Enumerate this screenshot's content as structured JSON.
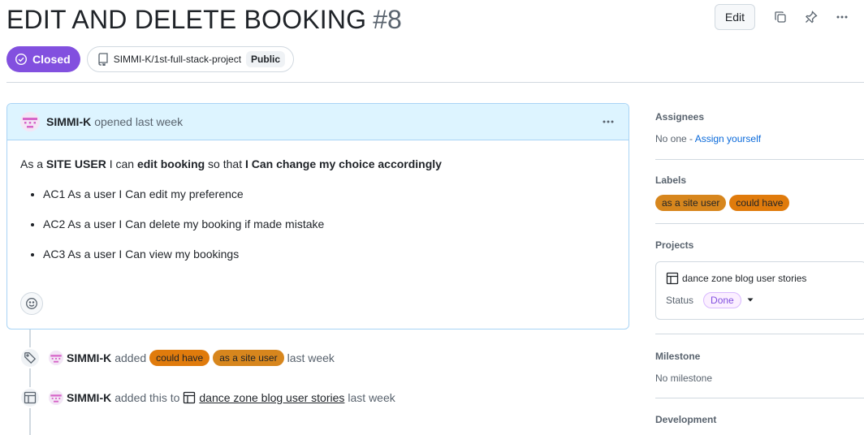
{
  "issue": {
    "title": "EDIT AND DELETE BOOKING",
    "number": "#8",
    "state": "Closed",
    "repo": "SIMMI-K/1st-full-stack-project",
    "visibility": "Public",
    "edit_label": "Edit"
  },
  "comment": {
    "author": "SIMMI-K",
    "action": "opened last week",
    "body": {
      "p1": "As a ",
      "b1": "SITE USER",
      "p2": " I can ",
      "b2": "edit booking",
      "p3": " so that ",
      "b3": "I Can change my choice accordingly"
    },
    "list": [
      "AC1 As a user I Can edit my preference",
      "AC2 As a user I Can delete my booking if made mistake",
      "AC3 As a user I Can view my bookings"
    ]
  },
  "timeline": [
    {
      "author": "SIMMI-K",
      "action": "added",
      "labels": [
        "could have",
        "as a site user"
      ],
      "time": "last week"
    },
    {
      "author": "SIMMI-K",
      "action": "added this to",
      "project": "dance zone blog user stories",
      "time": "last week"
    }
  ],
  "sidebar": {
    "assignees": {
      "title": "Assignees",
      "value": "No one - ",
      "link": "Assign yourself"
    },
    "labels": {
      "title": "Labels",
      "items": [
        "as a site user",
        "could have"
      ]
    },
    "projects": {
      "title": "Projects",
      "name": "dance zone blog user stories",
      "status_label": "Status",
      "status_value": "Done"
    },
    "milestone": {
      "title": "Milestone",
      "value": "No milestone"
    },
    "development": {
      "title": "Development"
    }
  },
  "colors": {
    "closed": "#8250df",
    "label_could_have": "#e07b0c",
    "label_site_user": "#d7861d",
    "comment_header": "#ddf4ff"
  }
}
